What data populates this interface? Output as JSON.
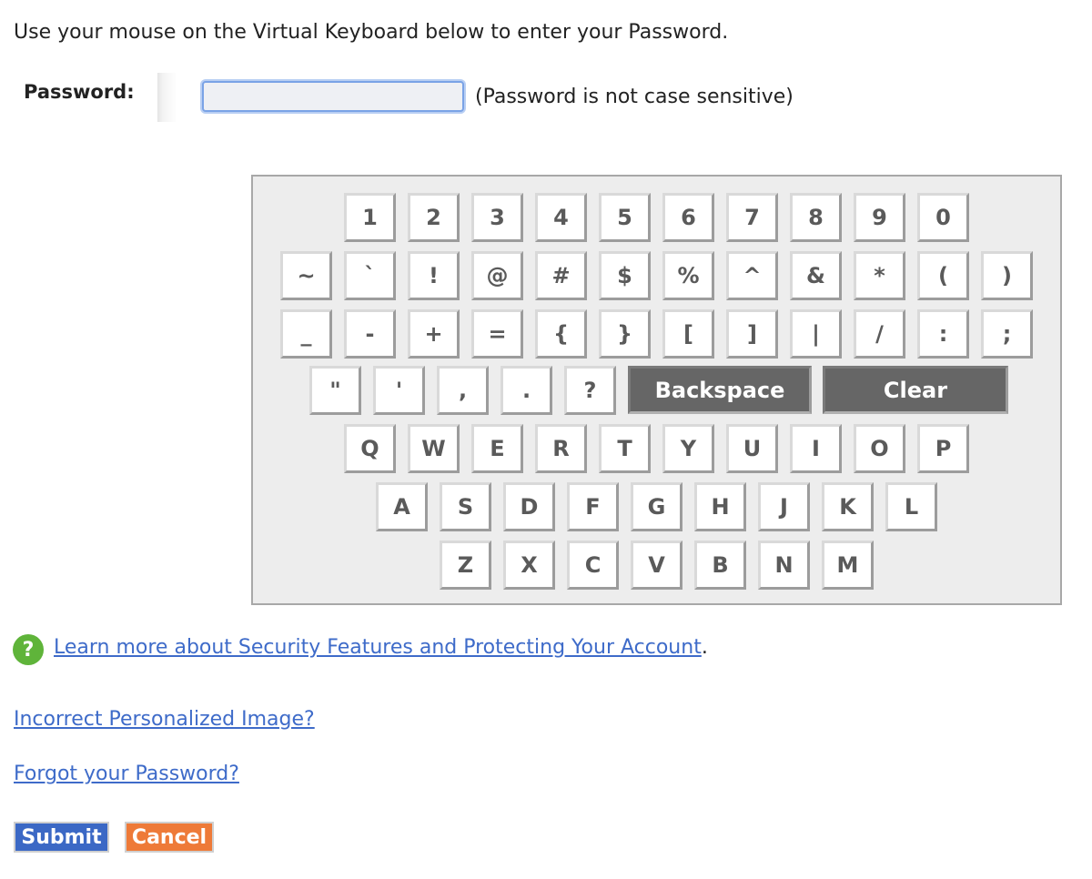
{
  "instruction": "Use your mouse on the Virtual Keyboard below to enter your Password.",
  "password": {
    "label": "Password:",
    "value": "",
    "hint": "(Password is not case sensitive)"
  },
  "keyboard": {
    "rows": [
      [
        "1",
        "2",
        "3",
        "4",
        "5",
        "6",
        "7",
        "8",
        "9",
        "0"
      ],
      [
        "~",
        "`",
        "!",
        "@",
        "#",
        "$",
        "%",
        "^",
        "&",
        "*",
        "(",
        ")"
      ],
      [
        "_",
        "-",
        "+",
        "=",
        "{",
        "}",
        "[",
        "]",
        "|",
        "/",
        ":",
        ";"
      ],
      [
        "\"",
        "'",
        ",",
        ".",
        "?"
      ],
      [
        "Q",
        "W",
        "E",
        "R",
        "T",
        "Y",
        "U",
        "I",
        "O",
        "P"
      ],
      [
        "A",
        "S",
        "D",
        "F",
        "G",
        "H",
        "J",
        "K",
        "L"
      ],
      [
        "Z",
        "X",
        "C",
        "V",
        "B",
        "N",
        "M"
      ]
    ],
    "backspace_label": "Backspace",
    "clear_label": "Clear"
  },
  "help": {
    "icon": "question-icon",
    "icon_glyph": "?",
    "link_text": "Learn more about Security Features and Protecting Your Account",
    "suffix": "."
  },
  "links": {
    "incorrect_image": "Incorrect Personalized Image?",
    "forgot_password": "Forgot your Password?"
  },
  "buttons": {
    "submit": "Submit",
    "cancel": "Cancel"
  },
  "colors": {
    "link": "#3e6bc9",
    "submit_bg": "#3b68c5",
    "cancel_bg": "#ee7a38",
    "help_icon": "#5fb43a",
    "wide_key_bg": "#666666"
  }
}
